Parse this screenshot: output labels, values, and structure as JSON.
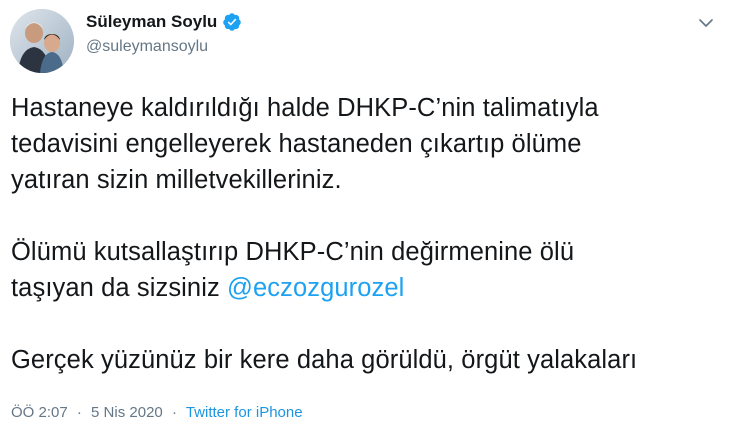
{
  "author": {
    "display_name": "Süleyman Soylu",
    "handle": "@suleymansoylu",
    "verified": true
  },
  "tweet": {
    "paragraph_1_line_1": "Hastaneye kaldırıldığı halde DHKP-C’nin talimatıyla",
    "paragraph_1_line_2": "tedavisini engelleyerek hastaneden çıkartıp ölüme",
    "paragraph_1_line_3": "yatıran sizin milletvekilleriniz.",
    "paragraph_2_line_1": "Ölümü kutsallaştırıp DHKP-C’nin değirmenine ölü",
    "paragraph_2_line_2_prefix": "taşıyan da sizsiniz ",
    "mention": "@eczozgurozel",
    "paragraph_3": "Gerçek yüzünüz bir kere daha görüldü, örgüt yalakaları"
  },
  "meta": {
    "time": "ÖÖ 2:07",
    "separator": "·",
    "date": "5 Nis 2020",
    "source": "Twitter for iPhone"
  },
  "icons": {
    "verified": "verified-badge-icon",
    "menu": "chevron-down-icon"
  },
  "colors": {
    "link": "#1da1f2",
    "verified": "#1da1f2",
    "muted": "#657786",
    "text": "#14171a"
  }
}
